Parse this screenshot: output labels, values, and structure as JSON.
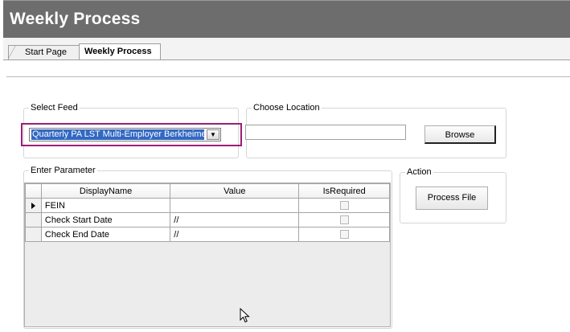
{
  "header": {
    "title": "Weekly Process"
  },
  "tabs": [
    {
      "label": "Start Page",
      "active": false
    },
    {
      "label": "Weekly Process",
      "active": true
    }
  ],
  "select_feed": {
    "legend": "Select Feed",
    "selected_value": "Quarterly PA LST Multi-Employer Berkheimer",
    "dropdown_icon": "chevron-down-icon",
    "highlight_color": "#9c1d78"
  },
  "choose_location": {
    "legend": "Choose Location",
    "path_value": "",
    "browse_label": "Browse"
  },
  "enter_parameter": {
    "legend": "Enter Parameter",
    "columns": [
      "DisplayName",
      "Value",
      "IsRequired"
    ],
    "rows": [
      {
        "display_name": "FEIN",
        "value": "",
        "is_required": false,
        "current": true
      },
      {
        "display_name": "Check Start Date",
        "value": "//",
        "is_required": false,
        "current": false
      },
      {
        "display_name": "Check End Date",
        "value": "//",
        "is_required": false,
        "current": false
      }
    ]
  },
  "action": {
    "legend": "Action",
    "process_label": "Process File"
  },
  "colors": {
    "title_bar": "#6d6d6d",
    "selection": "#3268c3"
  }
}
